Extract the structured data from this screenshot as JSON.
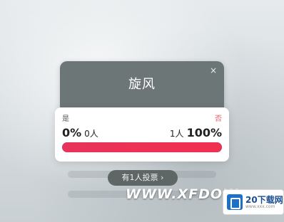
{
  "poll": {
    "title": "旋风",
    "close_symbol": "×",
    "left_option": "是",
    "right_option": "否",
    "left_percent": "0%",
    "left_count": "0人",
    "right_count": "1人",
    "right_percent": "100%",
    "right_share": 1.0,
    "vote_summary": "有1人投票 ›"
  },
  "watermark": {
    "text": "WWW.XFDOW",
    "logo_text": "20下载网",
    "logo_sub": "www.xxx.com"
  },
  "colors": {
    "header_bg": "#6d7676",
    "bar_left": "#3a7be0",
    "bar_right": "#f0304f",
    "right_option": "#e85b6a"
  },
  "icons": {
    "close": "close-icon",
    "chevron": "chevron-right-icon"
  }
}
